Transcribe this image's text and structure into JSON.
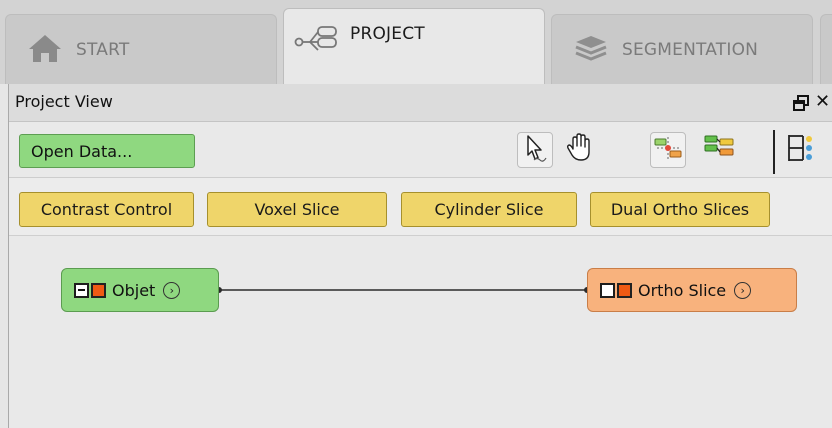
{
  "tabs": [
    {
      "label": "START",
      "icon": "home-icon",
      "active": false
    },
    {
      "label": "PROJECT",
      "icon": "project-graph-icon",
      "active": true
    },
    {
      "label": "SEGMENTATION",
      "icon": "layers-icon",
      "active": false
    }
  ],
  "panel": {
    "title": "Project View",
    "float_icon": "float-window-icon",
    "close_symbol": "✕"
  },
  "toolbar": {
    "open_data_label": "Open Data...",
    "tools": [
      {
        "name": "pointer-tool",
        "icon": "pointer-icon",
        "active": true
      },
      {
        "name": "hand-tool",
        "icon": "hand-icon",
        "active": false
      },
      {
        "name": "connect-tool",
        "icon": "connect-icon",
        "active": true
      },
      {
        "name": "tree-tool",
        "icon": "tree-icon",
        "active": false
      },
      {
        "name": "layout-tool",
        "icon": "layout-icon",
        "active": false
      }
    ]
  },
  "modules": {
    "contrast": "Contrast Control",
    "voxel": "Voxel Slice",
    "cylinder": "Cylinder Slice",
    "dual": "Dual Ortho Slices"
  },
  "graph": {
    "nodes": [
      {
        "label": "Objet",
        "color": "#8fd880"
      },
      {
        "label": "Ortho Slice",
        "color": "#f8b27d"
      }
    ],
    "arrow_symbol": "›"
  },
  "colors": {
    "module_yellow": "#efd56a",
    "data_green": "#8fd880",
    "display_orange": "#f8b27d",
    "viewer_orange": "#ef5a14"
  }
}
